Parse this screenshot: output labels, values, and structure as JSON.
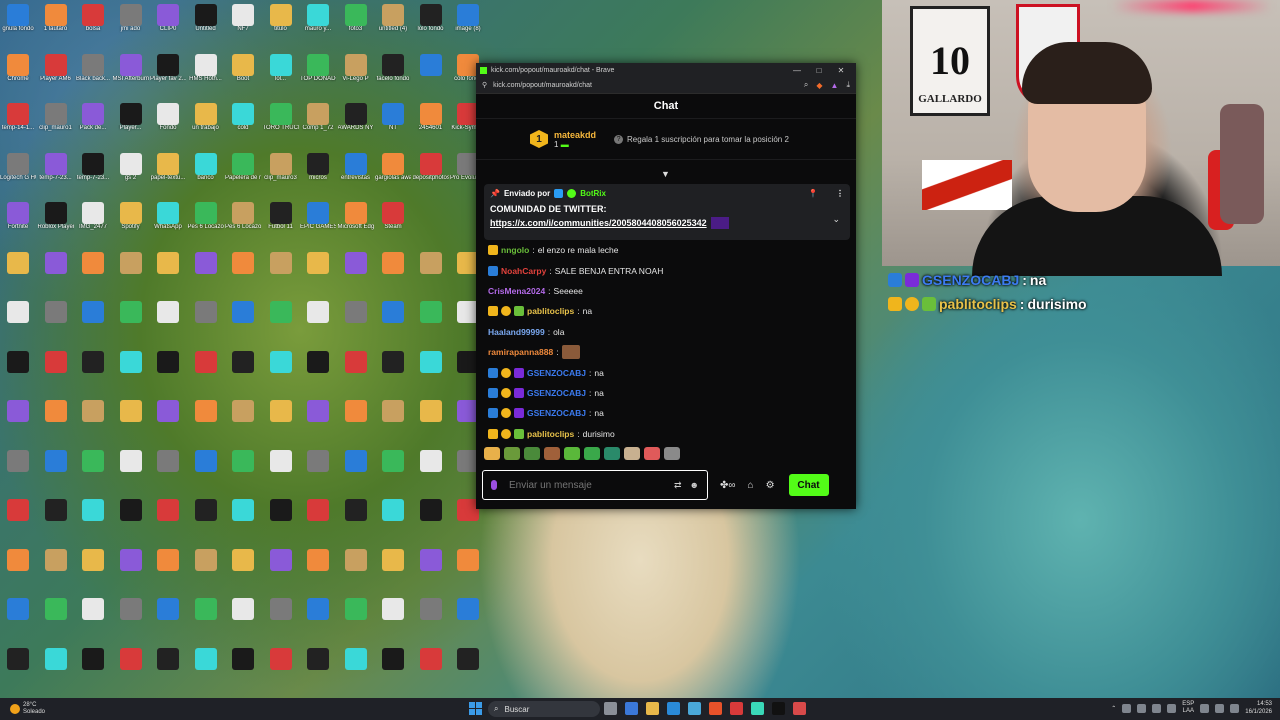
{
  "browser": {
    "tab_title": "kick.com/popout/mauroakd/chat - Brave",
    "url": "kick.com/popout/mauroakd/chat",
    "window_controls": [
      "—",
      "□",
      "✕"
    ]
  },
  "chat": {
    "header": "Chat",
    "sub_goal": {
      "rank": "1",
      "username": "mateakdd",
      "count": "1",
      "text": "Regala 1 suscripción para tomar la posición 2"
    },
    "pinned": {
      "sent_by_label": "Enviado por",
      "bot_name": "BotRix",
      "line1": "COMUNIDAD DE TWITTER:",
      "link": "https://x.com/i/communities/2005804408056025342"
    },
    "messages": [
      {
        "user": "nngolo",
        "color": "#6abf3a",
        "text": "el enzo re mala leche"
      },
      {
        "user": "NoahCarpy",
        "color": "#e2423c",
        "text": "SALE BENJA ENTRA NOAH"
      },
      {
        "user": "CrisMena2024",
        "color": "#b36ae8",
        "text": "Seeeee"
      },
      {
        "user": "pablitoclips",
        "color": "#e8c24a",
        "text": "na"
      },
      {
        "user": "Haaland99999",
        "color": "#7aa8f0",
        "text": "ola"
      },
      {
        "user": "ramirapanna888",
        "color": "#f08a3c",
        "text": ""
      },
      {
        "user": "GSENZOCABJ",
        "color": "#3c7bf0",
        "text": "na"
      },
      {
        "user": "GSENZOCABJ",
        "color": "#3c7bf0",
        "text": "na"
      },
      {
        "user": "GSENZOCABJ",
        "color": "#3c7bf0",
        "text": "na"
      },
      {
        "user": "pablitoclips",
        "color": "#e8c24a",
        "text": "durisimo"
      }
    ],
    "input_placeholder": "Enviar un mensaje",
    "send_label": "Chat"
  },
  "overlay": [
    {
      "user": "GSENZOCABJ",
      "color": "#3c7bf0",
      "text": "na"
    },
    {
      "user": "pablitoclips",
      "color": "#e8c24a",
      "text": "durisimo"
    }
  ],
  "webcam": {
    "frame_text": "GALLARDO",
    "frame_number": "10"
  },
  "desktop_icons": [
    "gnula fondo",
    "1 lautaro",
    "bolsa",
    "jmi ado",
    "CLIP0",
    "Untitled",
    "NF7",
    "titulo",
    "mauro y...",
    "foto3",
    "untitled (4)",
    "lolo fondo",
    "image (8)",
    "Chrome",
    "Player AM6",
    "Black back...",
    "MSI Afterburner",
    "Player fav 2...",
    "HMS Hoth...",
    "Boot",
    "lol...",
    "TOP DONADOR",
    "Vi-Lego P",
    "facelo fondo",
    "",
    "colo fondo",
    "temp-14-1...",
    "clip_mauro1",
    "Pack de...",
    "Player...",
    "Fondo",
    "un trabajo",
    "cold",
    "TORO TRUCH",
    "Comp 1_72",
    "AWARDS NY",
    "NT",
    "2454601",
    "Kick-Symbol",
    "Logitech G HUB",
    "temp-7-23...",
    "temp-7-23...",
    "gs 2",
    "papel-textu...",
    "banco",
    "Papelera de reciclaje",
    "clip_mauro3",
    "micros",
    "entrevistas",
    "gargiolas awards",
    "depositphotos",
    "Pro Evolution Soccer 6",
    "Fortnite",
    "Roblox Player",
    "IMG_2477",
    "Spotify",
    "WhatsApp",
    "Pes 6 Locazo",
    "Pes 6 Locazo",
    "Futbol 11",
    "EPIC GAMES",
    "Microsoft Edge",
    "Steam"
  ],
  "taskbar": {
    "weather_temp": "28°C",
    "weather_desc": "Soleado",
    "search_label": "Buscar",
    "lang_top": "ESP",
    "lang_bottom": "LAA",
    "time": "14:53",
    "date": "16/1/2026"
  },
  "colors": {
    "kick_green": "#53fc18",
    "taskbar_bg": "#1f2127",
    "chat_bg": "#0b0b0c"
  }
}
